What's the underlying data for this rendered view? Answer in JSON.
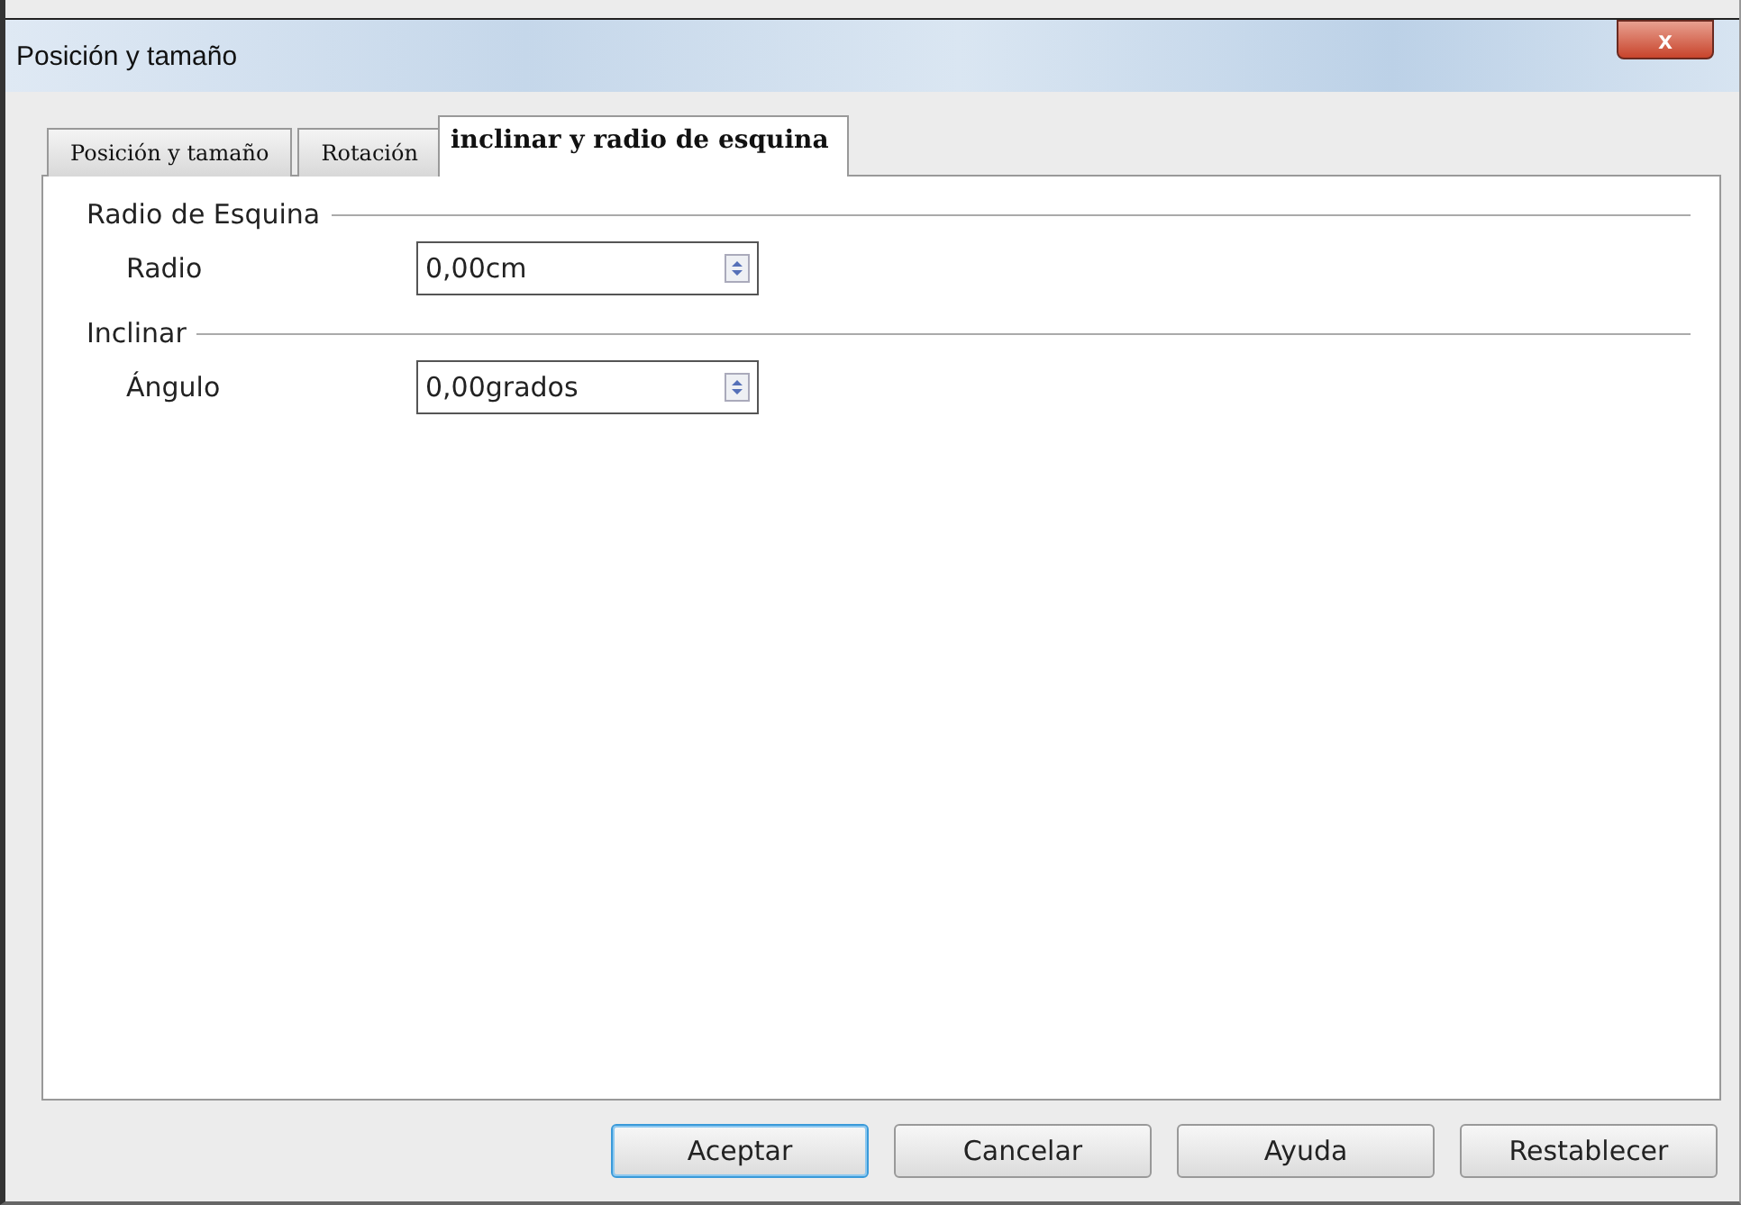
{
  "window": {
    "title": "Posición y tamaño",
    "close": "x"
  },
  "tabs": [
    {
      "label": "Posición y tamaño",
      "selected": false
    },
    {
      "label": "Rotación",
      "selected": false
    },
    {
      "label": "inclinar y radio de esquina",
      "selected": true
    }
  ],
  "sections": [
    {
      "title": "Radio de Esquina",
      "fields": [
        {
          "label": "Radio",
          "value": "0,00cm"
        }
      ]
    },
    {
      "title": "Inclinar",
      "fields": [
        {
          "label": "Ángulo",
          "value": "0,00grados"
        }
      ]
    }
  ],
  "buttons": [
    {
      "label": "Aceptar",
      "default": true
    },
    {
      "label": "Cancelar",
      "default": false
    },
    {
      "label": "Ayuda",
      "default": false
    },
    {
      "label": "Restablecer",
      "default": false
    }
  ]
}
